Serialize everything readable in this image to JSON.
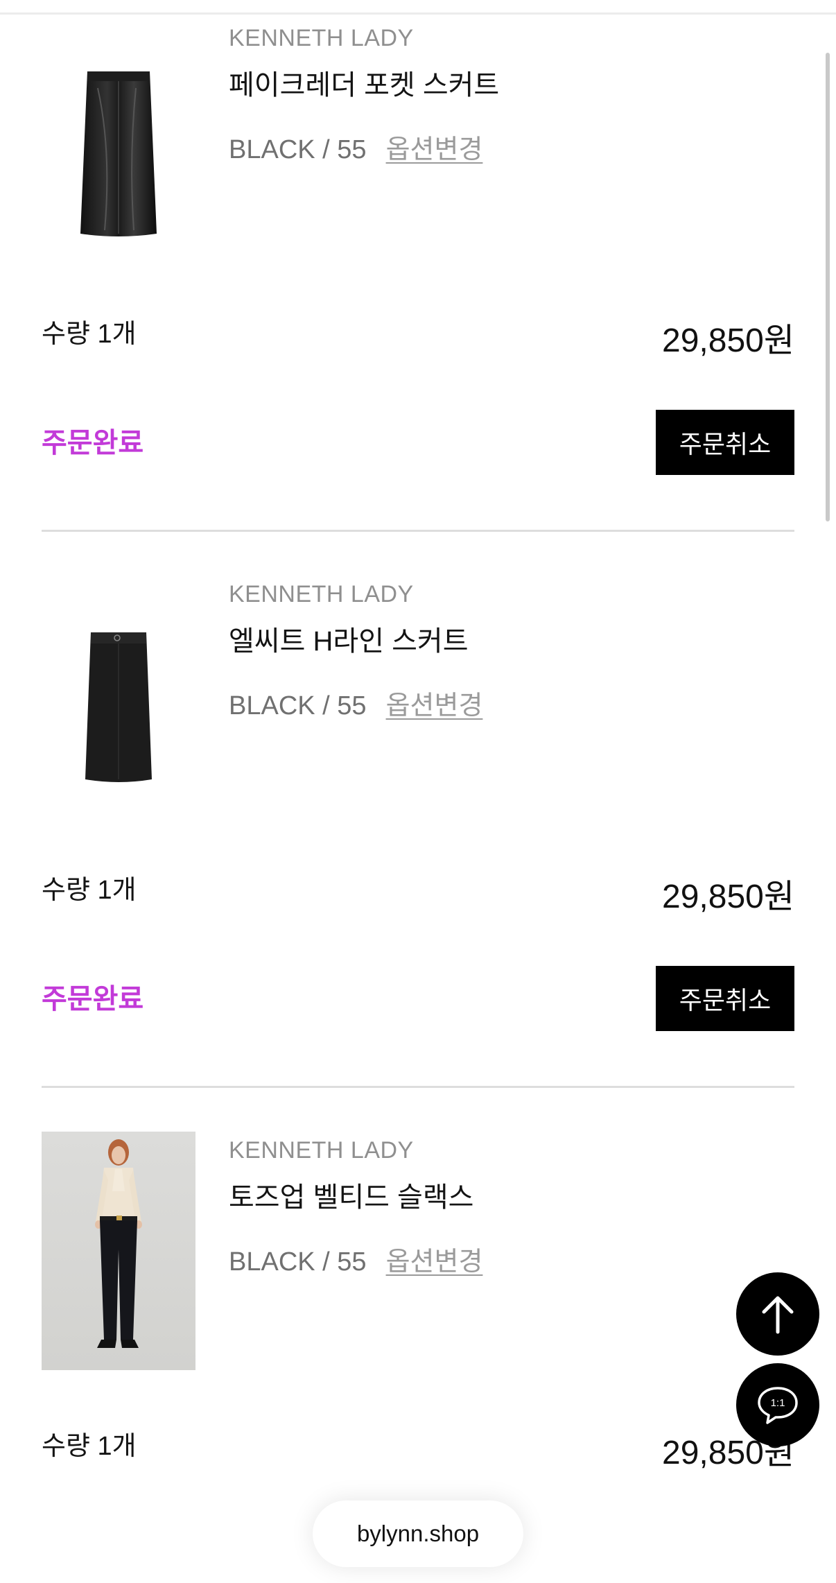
{
  "orders": [
    {
      "brand": "KENNETH LADY",
      "name": "페이크레더 포켓 스커트",
      "option": "BLACK / 55",
      "option_change_label": "옵션변경",
      "quantity_label": "수량 1개",
      "price": "29,850원",
      "status": "주문완료",
      "cancel_label": "주문취소",
      "image_icon": "leather-skirt-image"
    },
    {
      "brand": "KENNETH LADY",
      "name": "엘씨트 H라인 스커트",
      "option": "BLACK / 55",
      "option_change_label": "옵션변경",
      "quantity_label": "수량 1개",
      "price": "29,850원",
      "status": "주문완료",
      "cancel_label": "주문취소",
      "image_icon": "h-line-skirt-image"
    },
    {
      "brand": "KENNETH LADY",
      "name": "토즈업 벨티드 슬랙스",
      "option": "BLACK / 55",
      "option_change_label": "옵션변경",
      "quantity_label": "수량 1개",
      "price": "29,850원",
      "image_icon": "model-slacks-photo"
    }
  ],
  "floating": {
    "scroll_top_icon": "arrow-up-icon",
    "chat_icon": "chat-bubble-icon",
    "chat_label": "1:1"
  },
  "browser": {
    "domain": "bylynn.shop"
  },
  "colors": {
    "status": "#c23ad8",
    "button_bg": "#000000",
    "divider": "#dddddd"
  }
}
